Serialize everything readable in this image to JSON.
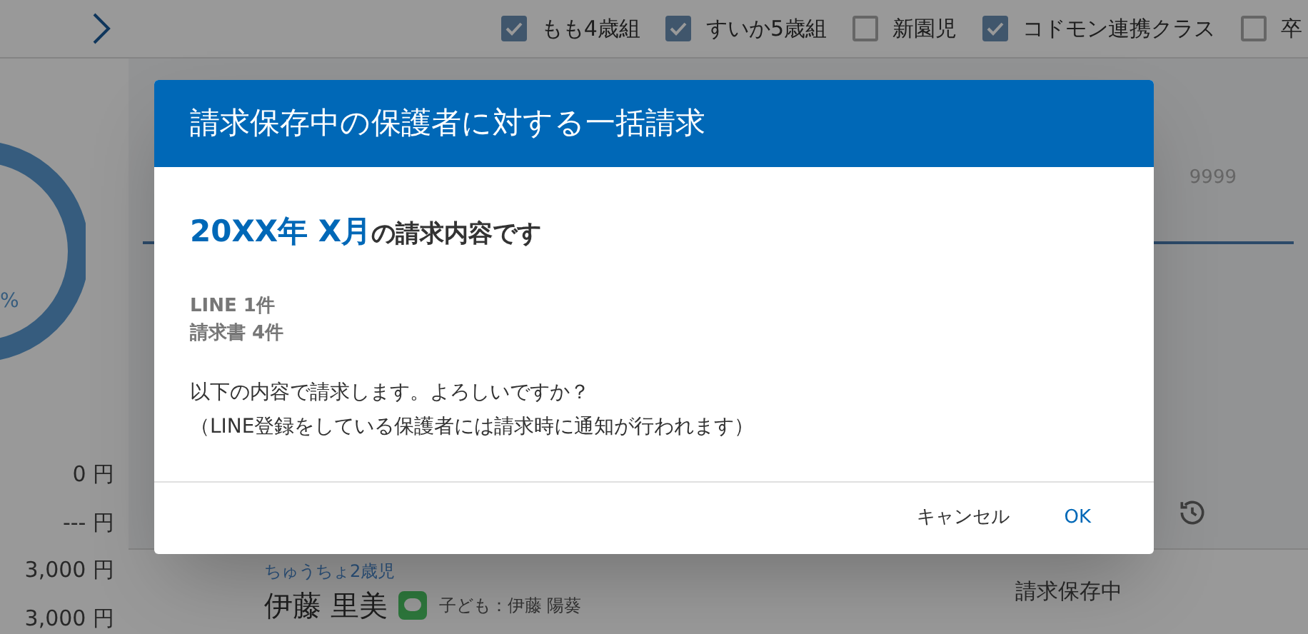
{
  "filters": [
    {
      "label": "もも4歳組",
      "checked": true
    },
    {
      "label": "すいか5歳組",
      "checked": true
    },
    {
      "label": "新園児",
      "checked": false
    },
    {
      "label": "コドモン連携クラス",
      "checked": true
    },
    {
      "label": "卒",
      "checked": false
    }
  ],
  "summary": {
    "donut_label": "%",
    "amounts": [
      "0 円",
      "--- 円",
      "3,000 円",
      "3,000 円"
    ]
  },
  "search": {
    "placeholder": "9999"
  },
  "row": {
    "class": "ちゅうちょ2歳児",
    "name": "伊藤 里美",
    "child": "子ども：伊藤 陽葵",
    "status": "請求保存中"
  },
  "dialog": {
    "title": "請求保存中の保護者に対する一括請求",
    "period": "20XX年 X月",
    "heading": "の請求内容です",
    "counts": [
      "LINE 1件",
      "請求書 4件"
    ],
    "message": [
      "以下の内容で請求します。よろしいですか？",
      "（LINE登録をしている保護者には請求時に通知が行われます）"
    ],
    "buttons": [
      {
        "label": "キャンセル",
        "kind": "cancel"
      },
      {
        "label": "OK",
        "kind": "ok"
      }
    ]
  }
}
